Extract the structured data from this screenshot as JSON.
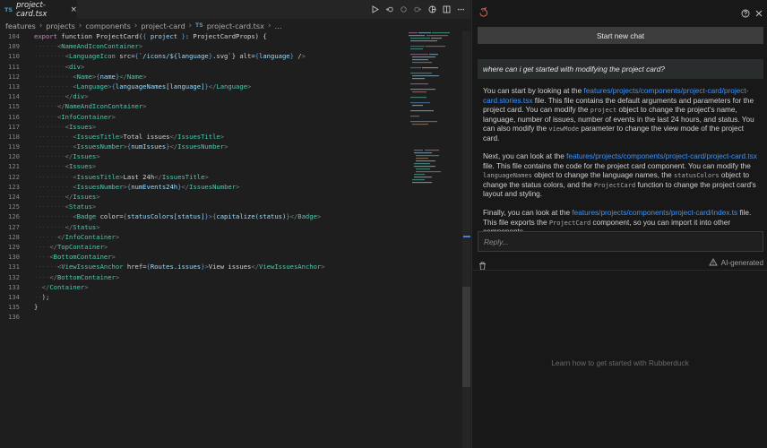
{
  "editor": {
    "tab": {
      "lang_badge": "TS",
      "file_name": "project-card.tsx",
      "close_glyph": "×"
    },
    "breadcrumb": [
      "features",
      "projects",
      "components",
      "project-card"
    ],
    "breadcrumb_file_badge": "TS",
    "breadcrumb_file": "project-card.tsx",
    "breadcrumb_more": "…",
    "line_numbers": [
      "109",
      "110",
      "111",
      "112",
      "113",
      "114",
      "115",
      "116",
      "117",
      "118",
      "119",
      "120",
      "121",
      "122",
      "123",
      "124",
      "125",
      "126",
      "127",
      "128",
      "129",
      "130",
      "131",
      "132",
      "133",
      "134",
      "135",
      "136"
    ],
    "first_line_number": "104",
    "code_lines": [
      "export function ProjectCard({ project }: ProjectCardProps) {",
      "      <NameAndIconContainer>",
      "        <LanguageIcon src={`/icons/${language}.svg`} alt={language} />",
      "        <div>",
      "          <Name>{name}</Name>",
      "          <Language>{languageNames[language]}</Language>",
      "        </div>",
      "      </NameAndIconContainer>",
      "      <InfoContainer>",
      "        <Issues>",
      "          <IssuesTitle>Total issues</IssuesTitle>",
      "          <IssuesNumber>{numIssues}</IssuesNumber>",
      "        </Issues>",
      "        <Issues>",
      "          <IssuesTitle>Last 24h</IssuesTitle>",
      "          <IssuesNumber>{numEvents24h}</IssuesNumber>",
      "        </Issues>",
      "        <Status>",
      "          <Badge color={statusColors[status]}>{capitalize(status)}</Badge>",
      "        </Status>",
      "      </InfoContainer>",
      "    </TopContainer>",
      "    <BottomContainer>",
      "      <ViewIssuesAnchor href={Routes.issues}>View issues</ViewIssuesAnchor>",
      "    </BottomContainer>",
      "  </Container>",
      "  );",
      "}",
      "",
      ""
    ]
  },
  "chat": {
    "new_chat_label": "Start new chat",
    "question": "where can i get started with modifying the project card?",
    "answer": {
      "p1_a": "You can start by looking at the ",
      "p1_link": "features/projects/components/project-card/project-card.stories.tsx",
      "p1_b": " file. This file contains the default arguments and parameters for the project card. You can modify the ",
      "p1_code1": "project",
      "p1_c": " object to change the project's name, language, number of issues, number of events in the last 24 hours, and status. You can also modify the ",
      "p1_code2": "viewMode",
      "p1_d": " parameter to change the view mode of the project card.",
      "p2_a": "Next, you can look at the ",
      "p2_link": "features/projects/components/project-card/project-card.tsx",
      "p2_b": " file. This file contains the code for the project card component. You can modify the ",
      "p2_code1": "languageNames",
      "p2_c": " object to change the language names, the ",
      "p2_code2": "statusColors",
      "p2_d": " object to change the status colors, and the ",
      "p2_code3": "ProjectCard",
      "p2_e": " function to change the project card's layout and styling.",
      "p3_a": "Finally, you can look at the ",
      "p3_link": "features/projects/components/project-card/index.ts",
      "p3_b": " file. This file exports the ",
      "p3_code1": "ProjectCard",
      "p3_c": " component, so you can import it into other components."
    },
    "reply_placeholder": "Reply...",
    "ai_generated_label": "AI-generated",
    "learn_label": "Learn how to get started with Rubberduck"
  },
  "icons": {
    "run": "play-icon",
    "history": "history-icon",
    "circle": "circle-icon",
    "split": "split-editor-icon",
    "more": "more-icon",
    "duck": "rubberduck-icon",
    "help": "help-icon",
    "close": "close-icon",
    "trash": "trash-icon",
    "warning": "warning-icon"
  },
  "colors": {
    "link": "#3794ff",
    "editor_bg": "#1e1e1e",
    "panel_bg": "#181818"
  }
}
